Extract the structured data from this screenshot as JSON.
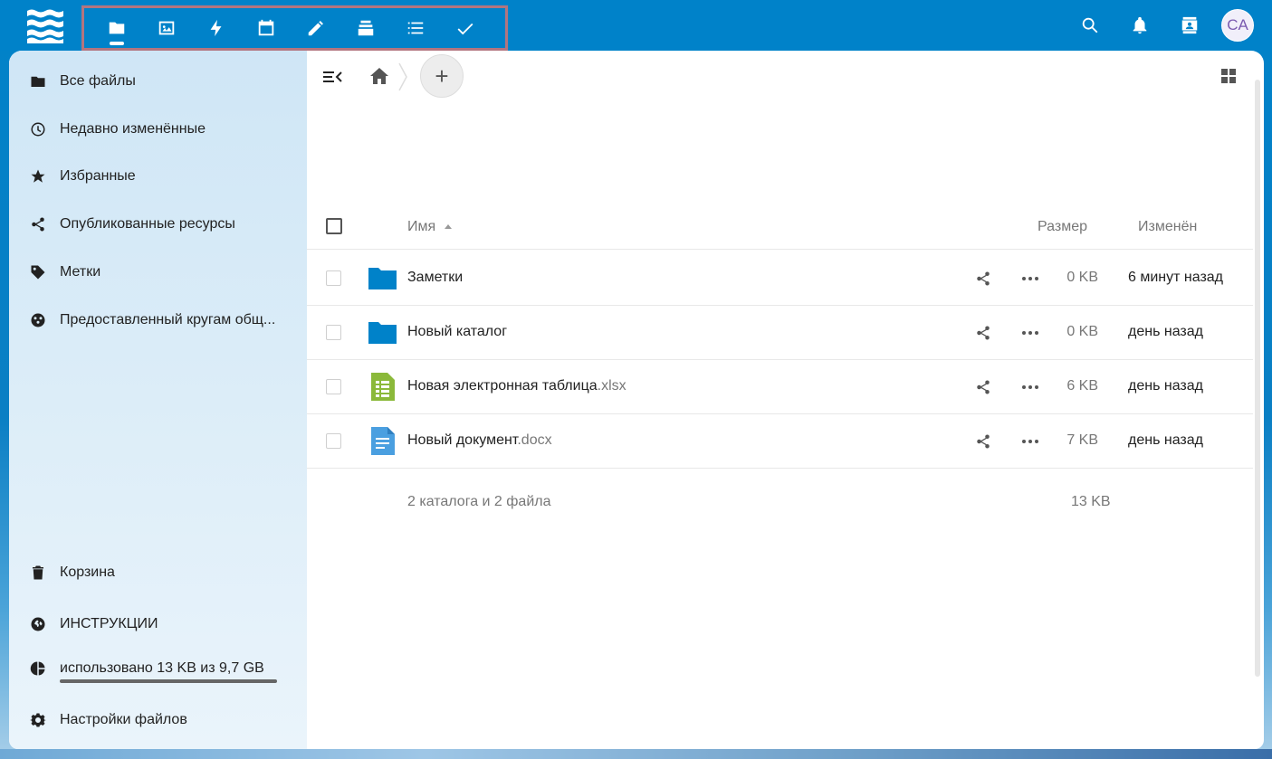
{
  "colors": {
    "header": "#0082c9",
    "folder": "#0082c9",
    "sheet": "#8bb93a",
    "doc": "#4a9fe0"
  },
  "header": {
    "apps": [
      {
        "name": "files-icon",
        "active": true
      },
      {
        "name": "photos-icon",
        "active": false
      },
      {
        "name": "activity-icon",
        "active": false
      },
      {
        "name": "calendar-icon",
        "active": false
      },
      {
        "name": "notes-icon",
        "active": false
      },
      {
        "name": "deck-icon",
        "active": false
      },
      {
        "name": "tasks-list-icon",
        "active": false
      },
      {
        "name": "checkmark-icon",
        "active": false
      }
    ],
    "avatar_initials": "CA"
  },
  "sidebar": {
    "items": [
      {
        "label": "Все файлы",
        "icon": "folder-icon"
      },
      {
        "label": "Недавно изменённые",
        "icon": "clock-icon"
      },
      {
        "label": "Избранные",
        "icon": "star-icon"
      },
      {
        "label": "Опубликованные ресурсы",
        "icon": "share-icon"
      },
      {
        "label": "Метки",
        "icon": "tag-icon"
      },
      {
        "label": "Предоставленный кругам общ...",
        "icon": "circles-icon"
      }
    ],
    "bottom": {
      "trash": "Корзина",
      "instructions": "ИНСТРУКЦИИ",
      "quota": "использовано 13 KB из 9,7 GB",
      "settings": "Настройки файлов"
    }
  },
  "table": {
    "col_name": "Имя",
    "col_size": "Размер",
    "col_modified": "Изменён",
    "rows": [
      {
        "name": "Заметки",
        "ext": "",
        "type": "folder",
        "size": "0 KB",
        "modified": "6 минут назад"
      },
      {
        "name": "Новый каталог",
        "ext": "",
        "type": "folder",
        "size": "0 KB",
        "modified": "день назад"
      },
      {
        "name": "Новая электронная таблица",
        "ext": ".xlsx",
        "type": "spreadsheet",
        "size": "6 KB",
        "modified": "день назад"
      },
      {
        "name": "Новый документ",
        "ext": ".docx",
        "type": "document",
        "size": "7 KB",
        "modified": "день назад"
      }
    ],
    "summary": "2 каталога и 2 файла",
    "summary_size": "13 KB"
  },
  "add_button": "+"
}
